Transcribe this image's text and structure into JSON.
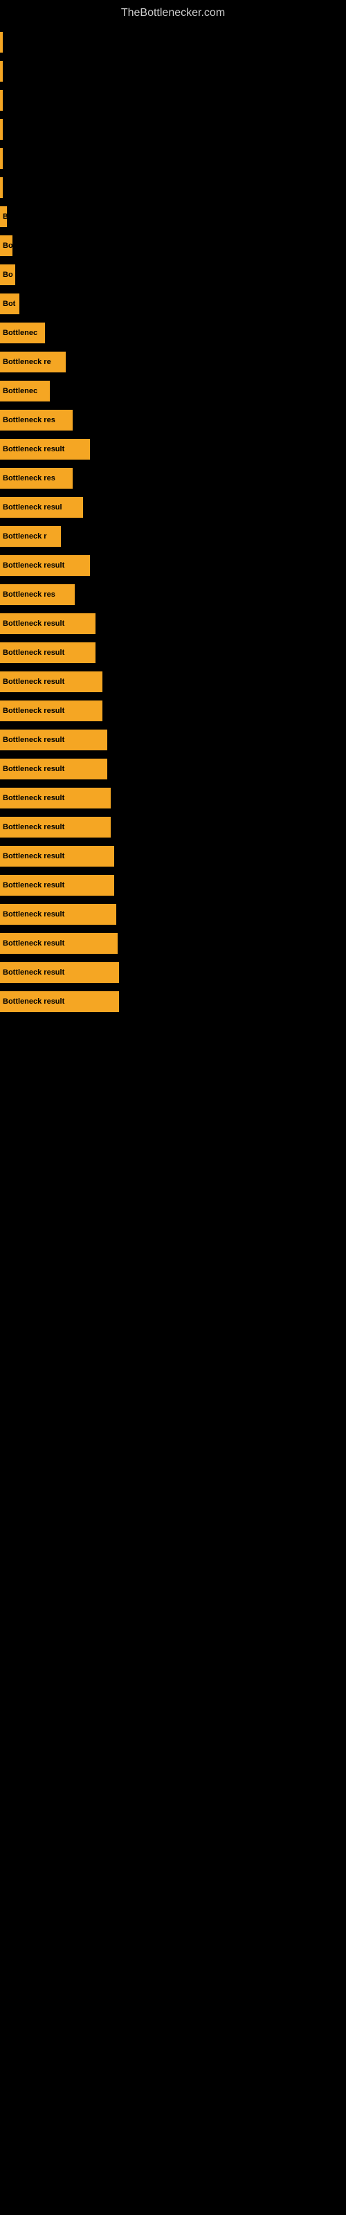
{
  "header": {
    "site_title": "TheBottlenecker.com"
  },
  "bars": [
    {
      "label": "",
      "width": 2
    },
    {
      "label": "",
      "width": 2
    },
    {
      "label": "",
      "width": 3
    },
    {
      "label": "",
      "width": 2
    },
    {
      "label": "",
      "width": 2
    },
    {
      "label": "",
      "width": 3
    },
    {
      "label": "B",
      "width": 10
    },
    {
      "label": "Bo",
      "width": 18
    },
    {
      "label": "Bo",
      "width": 22
    },
    {
      "label": "Bot",
      "width": 28
    },
    {
      "label": "Bottlenec",
      "width": 65
    },
    {
      "label": "Bottleneck re",
      "width": 95
    },
    {
      "label": "Bottlenec",
      "width": 72
    },
    {
      "label": "Bottleneck res",
      "width": 105
    },
    {
      "label": "Bottleneck result",
      "width": 130
    },
    {
      "label": "Bottleneck res",
      "width": 105
    },
    {
      "label": "Bottleneck resul",
      "width": 120
    },
    {
      "label": "Bottleneck r",
      "width": 88
    },
    {
      "label": "Bottleneck result",
      "width": 130
    },
    {
      "label": "Bottleneck res",
      "width": 108
    },
    {
      "label": "Bottleneck result",
      "width": 138
    },
    {
      "label": "Bottleneck result",
      "width": 138
    },
    {
      "label": "Bottleneck result",
      "width": 148
    },
    {
      "label": "Bottleneck result",
      "width": 148
    },
    {
      "label": "Bottleneck result",
      "width": 155
    },
    {
      "label": "Bottleneck result",
      "width": 155
    },
    {
      "label": "Bottleneck result",
      "width": 160
    },
    {
      "label": "Bottleneck result",
      "width": 160
    },
    {
      "label": "Bottleneck result",
      "width": 165
    },
    {
      "label": "Bottleneck result",
      "width": 165
    },
    {
      "label": "Bottleneck result",
      "width": 168
    },
    {
      "label": "Bottleneck result",
      "width": 170
    },
    {
      "label": "Bottleneck result",
      "width": 172
    },
    {
      "label": "Bottleneck result",
      "width": 172
    }
  ]
}
